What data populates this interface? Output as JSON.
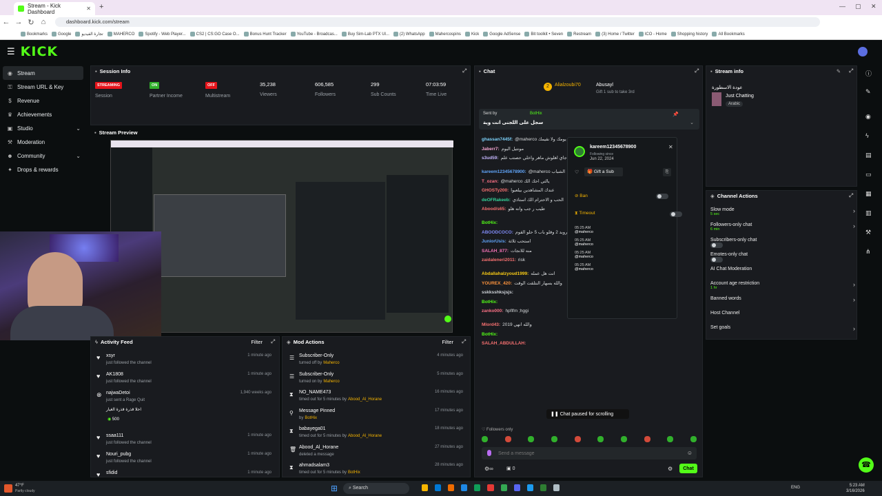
{
  "browser": {
    "tab_title": "Stream - Kick Dashboard",
    "url": "dashboard.kick.com/stream",
    "bookmarks": [
      "Bookmarks",
      "Google",
      "تجارة الفيديو",
      "MAHERCO",
      "Spotify - Web Player...",
      "CS2 | CS:GO Case O...",
      "Bonus Hunt Tracker",
      "YouTube - Broadcas...",
      "Buy Sim-Lab PTX Ul...",
      "(2) WhatsApp",
      "Mahercospins",
      "Kick",
      "Google AdSense",
      "Bit toolkit • Seven",
      "Restream",
      "(3) Home / Twitter",
      "ICO - Home",
      "Shopping history",
      "All Bookmarks"
    ]
  },
  "brand": {
    "logo": "KICK",
    "accent": "#53fc18"
  },
  "sidebar": {
    "items": [
      {
        "label": "Stream",
        "icon": "broadcast-icon"
      },
      {
        "label": "Stream URL & Key",
        "icon": "key-icon"
      },
      {
        "label": "Revenue",
        "icon": "dollar-icon"
      },
      {
        "label": "Achievements",
        "icon": "trophy-icon"
      },
      {
        "label": "Studio",
        "icon": "studio-icon"
      },
      {
        "label": "Moderation",
        "icon": "gavel-icon"
      },
      {
        "label": "Community",
        "icon": "people-icon"
      },
      {
        "label": "Drops & rewards",
        "icon": "gift-icon"
      }
    ]
  },
  "session": {
    "title": "Session Info",
    "stats": [
      {
        "value": "STREAMING",
        "label": "Session",
        "badge": true,
        "color": "#e5141b"
      },
      {
        "value": "ON",
        "label": "Partner Income",
        "badge": true,
        "color": "#31b02c"
      },
      {
        "value": "OFF",
        "label": "Multistream",
        "badge": true,
        "color": "#e5141b"
      },
      {
        "value": "35,238",
        "label": "Viewers"
      },
      {
        "value": "606,585",
        "label": "Followers"
      },
      {
        "value": "299",
        "label": "Sub Counts"
      },
      {
        "value": "07:03:59",
        "label": "Time Live"
      }
    ]
  },
  "preview": {
    "title": "Stream Preview"
  },
  "activity": {
    "title": "Activity Feed",
    "filter": "Filter",
    "items": [
      {
        "name": "xsyr",
        "action": "just followed the channel",
        "time": "1 minute ago"
      },
      {
        "name": "AK1808",
        "action": "just followed the channel",
        "time": "1 minute ago"
      },
      {
        "name": "najwaDetoi",
        "action": "just sent a Rage Quit",
        "time": "1,940 weeks ago",
        "note": "احلا قذرة قذرة الغيار",
        "amount": "500"
      },
      {
        "name": "ssaa111",
        "action": "just followed the channel",
        "time": "1 minute ago"
      },
      {
        "name": "Nouri_pubg",
        "action": "just followed the channel",
        "time": "1 minute ago"
      },
      {
        "name": "sfidid",
        "action": "",
        "time": "1 minute ago"
      }
    ]
  },
  "mod": {
    "title": "Mod Actions",
    "filter": "Filter",
    "items": [
      {
        "title": "Subscriber-Only",
        "action": "turned off by",
        "by": "Maherco",
        "time": "4 minutes ago"
      },
      {
        "title": "Subscriber-Only",
        "action": "turned on by",
        "by": "Maherco",
        "time": "5 minutes ago"
      },
      {
        "title": "NO_NAME473",
        "action": "timed out for 5 minutes by",
        "by": "Abood_Al_Horane",
        "time": "16 minutes ago"
      },
      {
        "title": "Message Pinned",
        "action": "by",
        "by": "BotHix",
        "time": "17 minutes ago"
      },
      {
        "title": "babayega01",
        "action": "timed out for 5 minutes by",
        "by": "Abood_Al_Horane",
        "time": "18 minutes ago"
      },
      {
        "title": "Abood_Al_Horane",
        "action": "deleted a message",
        "by": "",
        "time": "27 minutes ago"
      },
      {
        "title": "ahmadsalam3",
        "action": "timed out for 5 minutes by",
        "by": "BotHix",
        "time": "28 minutes ago"
      }
    ]
  },
  "chat": {
    "title": "Chat",
    "top_users": [
      {
        "name": "Alialzoubi70",
        "rank": "2"
      },
      {
        "name": "Abusayl",
        "rank": "1"
      }
    ],
    "gift_note": "Gift 1 sub to take 3rd",
    "pinned_by": "Sent by",
    "pinned_bot": "BotHix",
    "pinned_text": "سجل على اللجنى انت وية",
    "lines": [
      {
        "user": "ghassan7445f:",
        "color": "#7dd3fc",
        "text": "@maherco يومك ولا نقيمك"
      },
      {
        "user": "Jaberr7:",
        "color": "#f9a8d4",
        "text": "مونتيل اليوم"
      },
      {
        "user": "s3ud59:",
        "color": "#c4b5fd",
        "text": "و جاي اهلوش ماهر واخلي حصتب علم"
      },
      {
        "user": "kareem12345678900:",
        "color": "#60a5fa",
        "text": "@maherco الشباب"
      },
      {
        "user": "T_ozan:",
        "color": "#fb7185",
        "text": "@maherco يالتي احك الك"
      },
      {
        "user": "GHOSTy200:",
        "color": "#f87171",
        "text": "عندك المشاهدين بيلعبوا"
      },
      {
        "user": "deOFRakeeb:",
        "color": "#34d399",
        "text": "الحب و الاحترام الك استاذي"
      },
      {
        "user": "Abood/s65:",
        "color": "#f87171",
        "text": "طيب ر جب وانه هلو"
      },
      {
        "user": "BotHix:",
        "color": "#53fc18",
        "text": ""
      },
      {
        "user": "ABOODCOCO:",
        "color": "#818cf8",
        "text": "بيروبد 2 وقلو باب 5 حلو القوم"
      },
      {
        "user": "JuniorUsis:",
        "color": "#60a5fa",
        "text": "استحب ثلاثة"
      },
      {
        "user": "SALAH_877:",
        "color": "#f472b6",
        "text": "منه للانجات"
      },
      {
        "user": "zaidaleneri2011:",
        "color": "#f87171",
        "text": "risk"
      },
      {
        "user": "Abdallahalzyoud1999:",
        "color": "#facc15",
        "text": "انت هل عمله"
      },
      {
        "user": "YOUREX_420:",
        "color": "#fb923c",
        "text": "والله بسهار النتلقت الوقت"
      },
      {
        "user": "sskksshksjsjs:",
        "color": "#d1d5db",
        "text": ""
      },
      {
        "user": "BotHix:",
        "color": "#53fc18",
        "text": ""
      },
      {
        "user": "zanko000:",
        "color": "#fb7185",
        "text": "hpflfm ;hggi"
      },
      {
        "user": "Mlord43:",
        "color": "#f87171",
        "text": "2019 والله انهي"
      },
      {
        "user": "BotHix:",
        "color": "#53fc18",
        "text": ""
      },
      {
        "user": "SALAH_ABDULLAH:",
        "color": "#f87171",
        "text": ""
      }
    ],
    "paused": "Chat paused for scrolling",
    "mode": "Followers only",
    "placeholder": "Send a message",
    "send": "Chat",
    "count": "0"
  },
  "popup": {
    "username": "kareem12345678900",
    "following_since_label": "Following since",
    "following_since": "Jun 22, 2024",
    "gift": "Gift a Sub",
    "ban": "Ban",
    "timeout": "Timeout",
    "mention": "@maherco",
    "times": [
      "05:25 AM",
      "05:25 AM",
      "05:25 AM",
      "05:25 AM"
    ]
  },
  "stream_info": {
    "title": "Stream info",
    "stream_title": "عودة الاسطورة",
    "category": "Just Chatting",
    "language": "Arabic"
  },
  "actions": {
    "title": "Channel Actions",
    "items": [
      {
        "label": "Slow mode",
        "value": "5 sec",
        "type": "chevron"
      },
      {
        "label": "Followers-only chat",
        "value": "6 min",
        "type": "chevron"
      },
      {
        "label": "Subscribers-only chat",
        "value": "",
        "type": "toggle"
      },
      {
        "label": "Emotes-only chat",
        "value": "",
        "type": "toggle"
      },
      {
        "label": "AI Chat Moderation",
        "value": "",
        "type": "none"
      },
      {
        "label": "Account age restriction",
        "value": "1 hr",
        "type": "chevron"
      },
      {
        "label": "Banned words",
        "value": "",
        "type": "chevron"
      },
      {
        "label": "Host Channel",
        "value": "",
        "type": "none"
      },
      {
        "label": "Set goals",
        "value": "",
        "type": "chevron"
      }
    ]
  },
  "taskbar": {
    "weather_temp": "47°F",
    "weather": "Partly cloudy",
    "search": "Search",
    "lang": "ENG",
    "time": "5:23 AM",
    "date": "3/16/2026"
  }
}
